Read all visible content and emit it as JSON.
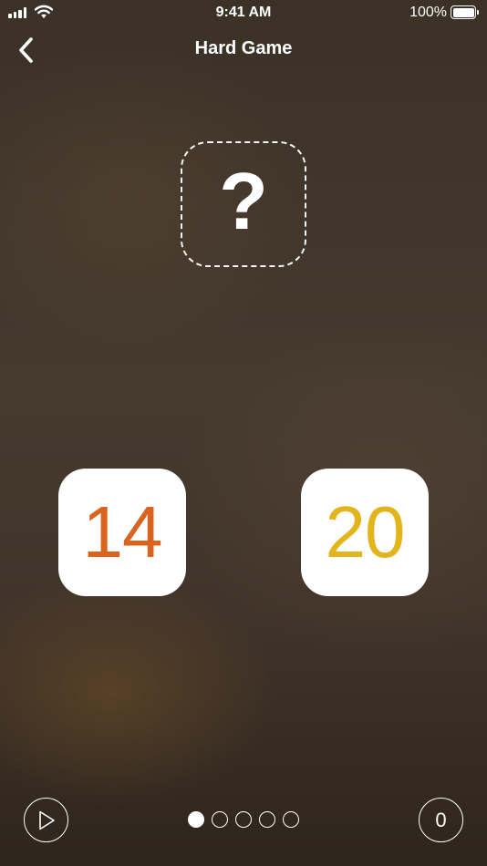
{
  "status_bar": {
    "time": "9:41 AM",
    "battery_percent": "100%",
    "battery_level": 1.0,
    "icons": [
      "signal-icon",
      "wifi-icon",
      "battery-icon"
    ]
  },
  "nav": {
    "title": "Hard Game",
    "back_icon": "chevron-left-icon"
  },
  "target": {
    "symbol": "?"
  },
  "tiles": [
    {
      "value": "14",
      "color": "#d8641f"
    },
    {
      "value": "20",
      "color": "#e3b51c"
    }
  ],
  "controls": {
    "play_icon": "play-icon",
    "score": "0"
  },
  "pagination": {
    "total": 5,
    "current": 1
  }
}
